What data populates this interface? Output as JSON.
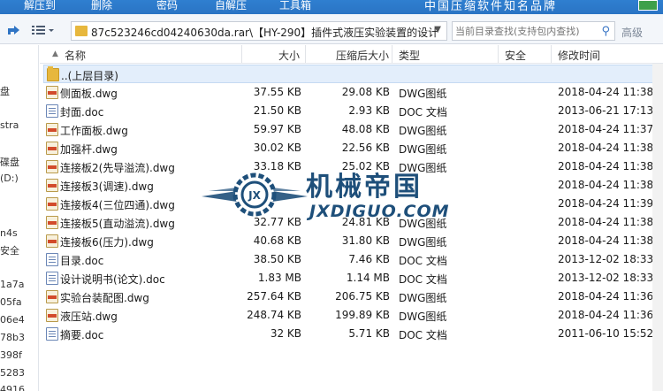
{
  "toolbar": {
    "items": [
      "解压到",
      "删除",
      "密码",
      "自解压",
      "工具箱"
    ],
    "brand": "中国压缩软件知名品牌"
  },
  "address": {
    "path": "87c523246cd04240630da.rar\\【HY-290】插件式液压实验装置的设计",
    "search_placeholder": "当前目录查找(支持包内查找)",
    "advanced_label": "高级"
  },
  "left_pane": {
    "items": [
      "盘",
      "stra",
      "碟盘",
      "(D:)",
      "n4s",
      "安全",
      "1a7a",
      "05fa",
      "06e4",
      "78b3",
      "398f",
      "5283",
      "4916"
    ]
  },
  "columns": {
    "name": "名称",
    "size": "大小",
    "packed": "压缩后大小",
    "type": "类型",
    "security": "安全",
    "modified": "修改时间"
  },
  "files": [
    {
      "icon": "folder",
      "name": "..(上层目录)",
      "size": "",
      "packed": "",
      "type": "",
      "modified": ""
    },
    {
      "icon": "dwg",
      "name": "侧面板.dwg",
      "size": "37.55 KB",
      "packed": "29.08 KB",
      "type": "DWG图纸",
      "modified": "2018-04-24 11:38:"
    },
    {
      "icon": "doc",
      "name": "封面.doc",
      "size": "21.50 KB",
      "packed": "2.93 KB",
      "type": "DOC 文档",
      "modified": "2013-06-21 17:13:"
    },
    {
      "icon": "dwg",
      "name": "工作面板.dwg",
      "size": "59.97 KB",
      "packed": "48.08 KB",
      "type": "DWG图纸",
      "modified": "2018-04-24 11:37:"
    },
    {
      "icon": "dwg",
      "name": "加强杆.dwg",
      "size": "30.02 KB",
      "packed": "22.56 KB",
      "type": "DWG图纸",
      "modified": "2018-04-24 11:38:"
    },
    {
      "icon": "dwg",
      "name": "连接板2(先导溢流).dwg",
      "size": "33.18 KB",
      "packed": "25.02 KB",
      "type": "DWG图纸",
      "modified": "2018-04-24 11:38:"
    },
    {
      "icon": "dwg",
      "name": "连接板3(调速).dwg",
      "size": "",
      "packed": "",
      "type": "",
      "modified": "2018-04-24 11:38:"
    },
    {
      "icon": "dwg",
      "name": "连接板4(三位四通).dwg",
      "size": "",
      "packed": "",
      "type": "",
      "modified": "2018-04-24 11:39:"
    },
    {
      "icon": "dwg",
      "name": "连接板5(直动溢流).dwg",
      "size": "32.77 KB",
      "packed": "24.81 KB",
      "type": "DWG图纸",
      "modified": "2018-04-24 11:38:"
    },
    {
      "icon": "dwg",
      "name": "连接板6(压力).dwg",
      "size": "40.68 KB",
      "packed": "31.80 KB",
      "type": "DWG图纸",
      "modified": "2018-04-24 11:38:"
    },
    {
      "icon": "doc",
      "name": "目录.doc",
      "size": "38.50 KB",
      "packed": "7.46 KB",
      "type": "DOC 文档",
      "modified": "2013-12-02 18:33:"
    },
    {
      "icon": "doc",
      "name": "设计说明书(论文).doc",
      "size": "1.83 MB",
      "packed": "1.14 MB",
      "type": "DOC 文档",
      "modified": "2013-12-02 18:33:"
    },
    {
      "icon": "dwg",
      "name": "实验台装配图.dwg",
      "size": "257.64 KB",
      "packed": "206.75 KB",
      "type": "DWG图纸",
      "modified": "2018-04-24 11:36:"
    },
    {
      "icon": "dwg",
      "name": "液压站.dwg",
      "size": "248.74 KB",
      "packed": "199.89 KB",
      "type": "DWG图纸",
      "modified": "2018-04-24 11:36:"
    },
    {
      "icon": "doc",
      "name": "摘要.doc",
      "size": "32 KB",
      "packed": "5.71 KB",
      "type": "DOC 文档",
      "modified": "2011-06-10 15:52:"
    }
  ],
  "watermark": {
    "title": "机械帝国",
    "subtitle": "JXDIGUO.COM"
  }
}
